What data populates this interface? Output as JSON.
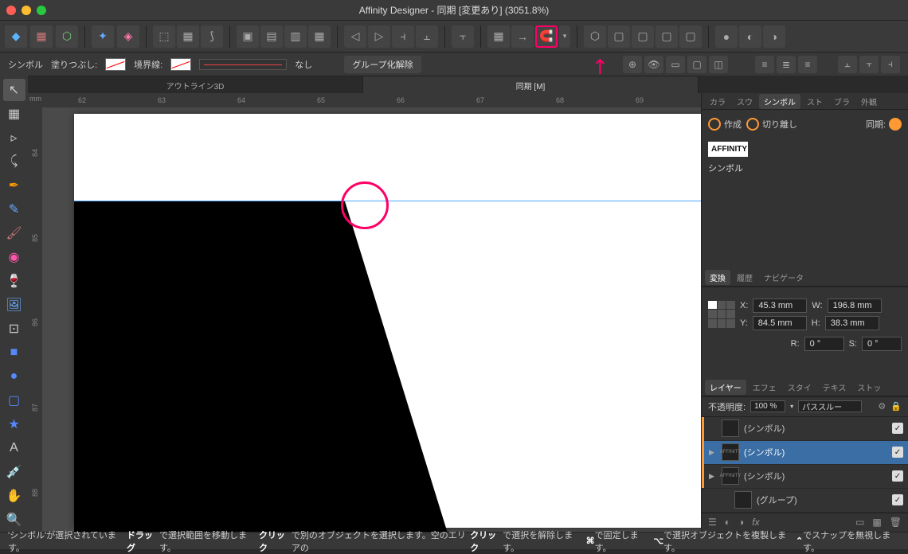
{
  "app": {
    "title": "Affinity Designer - 同期 [変更あり] (3051.8%)"
  },
  "context": {
    "symbol_label": "シンボル",
    "fill_label": "塗りつぶし:",
    "stroke_label": "境界線:",
    "stroke_value": "なし",
    "ungroup_label": "グループ化解除"
  },
  "doctabs": {
    "a": "アウトライン3D",
    "b": "同期 [M]"
  },
  "ruler": {
    "unit": "mm",
    "h": [
      "62",
      "63",
      "64",
      "65",
      "66",
      "67",
      "68",
      "69"
    ],
    "v": [
      "84",
      "85",
      "86",
      "87",
      "88"
    ]
  },
  "right_tabs": {
    "color": "カラ",
    "swatch": "スウ",
    "symbol": "シンボル",
    "stock": "スト",
    "brush": "ブラ",
    "appearance": "外観"
  },
  "symbol_panel": {
    "create": "作成",
    "detach": "切り離し",
    "sync_label": "同期:",
    "group_title": "AFFINITY",
    "item": "シンボル"
  },
  "transform_tabs": {
    "transform": "変換",
    "history": "履歴",
    "navigator": "ナビゲータ"
  },
  "transform": {
    "x_label": "X:",
    "x": "45.3 mm",
    "y_label": "Y:",
    "y": "84.5 mm",
    "w_label": "W:",
    "w": "196.8 mm",
    "h_label": "H:",
    "h": "38.3 mm",
    "r_label": "R:",
    "r": "0 °",
    "s_label": "S:",
    "s": "0 °"
  },
  "layer_tabs": {
    "layers": "レイヤー",
    "effects": "エフェ",
    "styles": "スタイ",
    "text": "テキス",
    "stock": "ストッ"
  },
  "layers": {
    "opacity_label": "不透明度:",
    "opacity": "100 %",
    "blend": "パススルー",
    "items": [
      {
        "name": "(シンボル)",
        "thumb": "",
        "expandable": false
      },
      {
        "name": "(シンボル)",
        "thumb": "AFFINITY",
        "expandable": true,
        "selected": true
      },
      {
        "name": "(シンボル)",
        "thumb": "AFFINITY",
        "expandable": true
      },
      {
        "name": "(グループ)",
        "thumb": "",
        "expandable": false
      }
    ]
  },
  "status": {
    "text_pre": "'シンボル'が選択されています。",
    "drag_b": "ドラッグ",
    "drag_t": "で選択範囲を移動します。",
    "click_b": "クリック",
    "click_t": "で別のオブジェクトを選択します。空のエリアの",
    "click2_b": "クリック",
    "click2_t": "で選択を解除します。",
    "cmd_b": "⌘",
    "cmd_t": "で固定します。",
    "opt_b": "⌥",
    "opt_t": "で選択オブジェクトを複製します。",
    "ctrl_b": "⌃",
    "ctrl_t": "でスナップを無視します。"
  }
}
